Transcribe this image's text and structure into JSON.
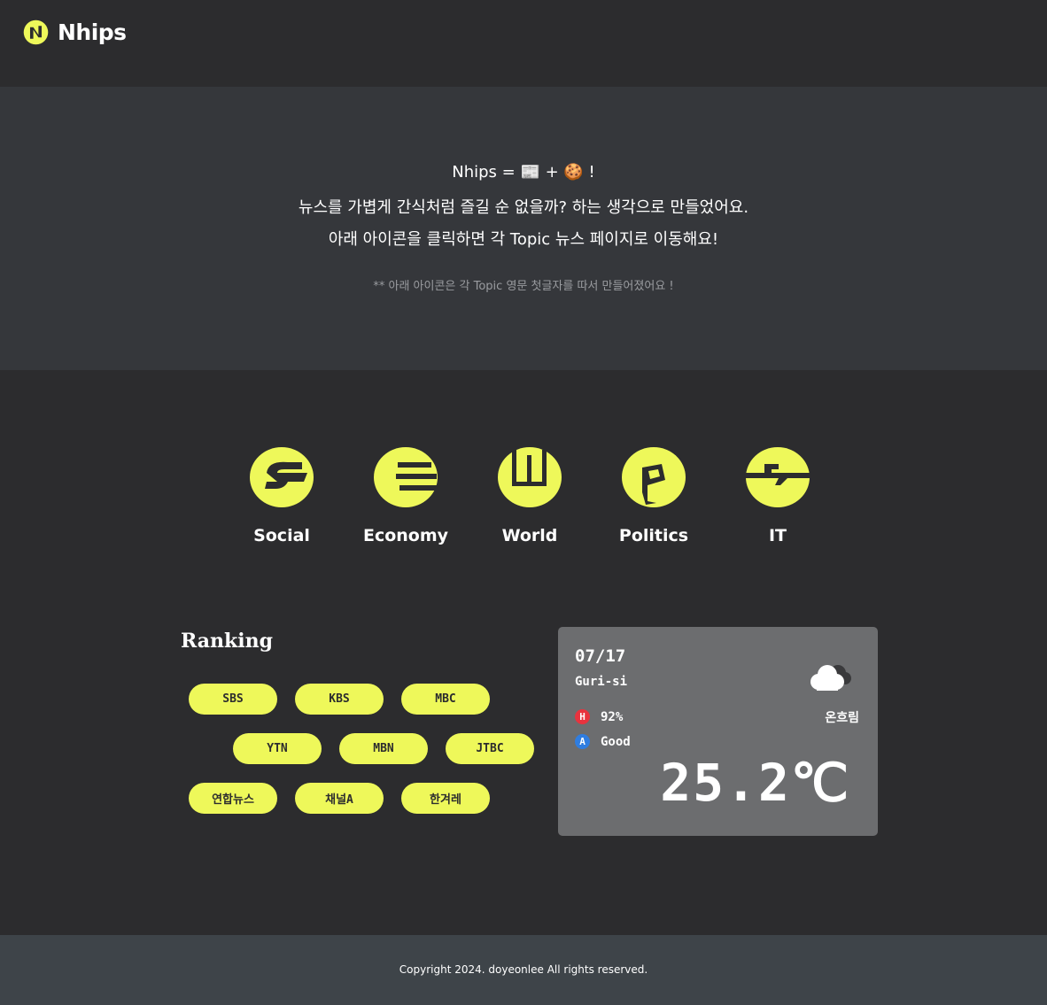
{
  "header": {
    "logo_text": "Nhips",
    "logo_color": "#eef85a"
  },
  "intro": {
    "line1": "Nhips = 📰 + 🍪 !",
    "line2": "뉴스를 가볍게 간식처럼 즐길 순 없을까? 하는 생각으로 만들었어요.",
    "line3": "아래 아이콘을 클릭하면 각 Topic 뉴스 페이지로 이동해요!",
    "note": "** 아래 아이콘은 각 Topic 영문 첫글자를 따서 만들어졌어요 !"
  },
  "topics": [
    {
      "label": "Social",
      "icon": "social-s-icon"
    },
    {
      "label": "Economy",
      "icon": "economy-e-icon"
    },
    {
      "label": "World",
      "icon": "world-w-icon"
    },
    {
      "label": "Politics",
      "icon": "politics-p-icon"
    },
    {
      "label": "IT",
      "icon": "it-icon"
    }
  ],
  "ranking": {
    "title": "Ranking",
    "outlets": [
      "SBS",
      "KBS",
      "MBC",
      "YTN",
      "MBN",
      "JTBC",
      "연합뉴스",
      "채널A",
      "한겨레"
    ]
  },
  "weather": {
    "date": "07/17",
    "city": "Guri-si",
    "humidity_badge": "H",
    "humidity": "92%",
    "air_badge": "A",
    "air_quality": "Good",
    "condition": "온흐림",
    "temperature": "25.2℃",
    "icon": "cloud-icon"
  },
  "footer": {
    "copyright": "Copyright 2024. doyeonlee All rights reserved."
  },
  "colors": {
    "accent": "#eef85a",
    "bg": "#2c2c2e",
    "intro_bg": "#35373b",
    "weather_card": "#6c6d6f",
    "footer_bg": "#3e4449",
    "humidity_red": "#e8333e",
    "air_blue": "#2f7de0"
  }
}
